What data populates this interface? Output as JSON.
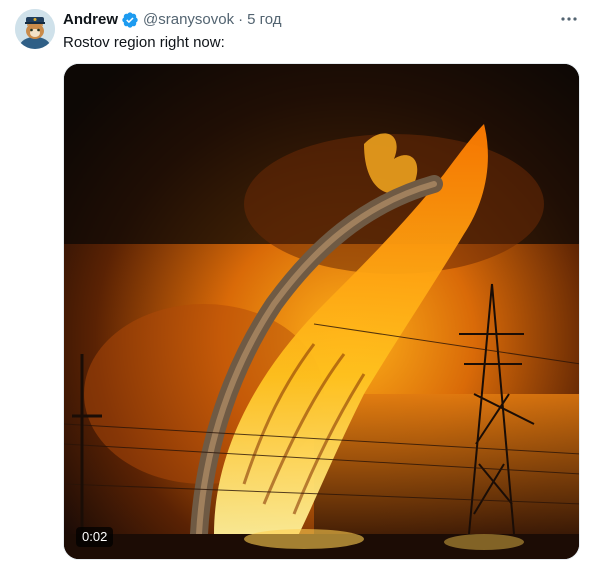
{
  "author": {
    "name": "Andrew",
    "handle": "@sranysovok",
    "separator": "·",
    "time": "5 год"
  },
  "tweet": {
    "text": "Rostov region right now:"
  },
  "media": {
    "duration": "0:02"
  },
  "icons": {
    "verified": "verified-badge-icon",
    "more": "more-options-icon"
  },
  "colors": {
    "verified": "#1d9bf0",
    "text": "#0f1419",
    "secondary": "#536471"
  }
}
